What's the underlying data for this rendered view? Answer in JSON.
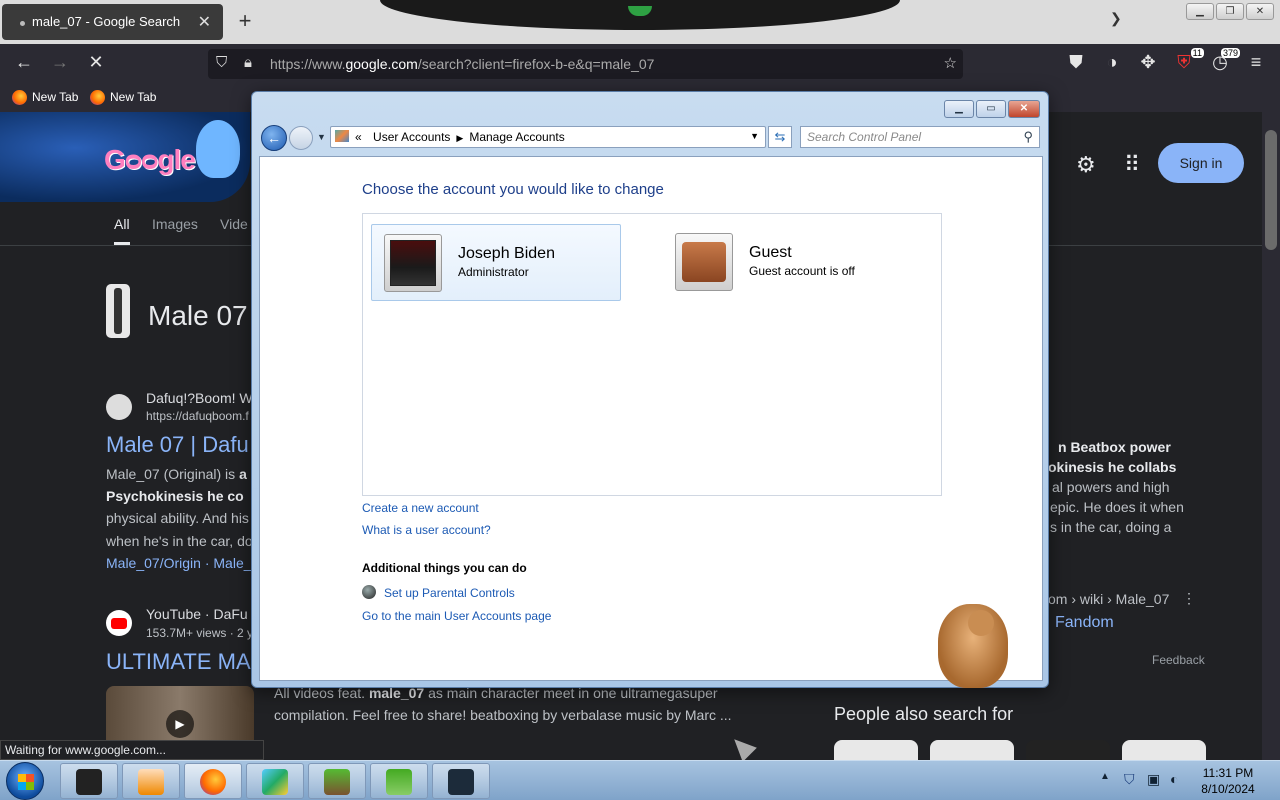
{
  "browser": {
    "tab_title": "male_07 - Google Search",
    "url_prefix": "https://www.",
    "url_domain": "google.com",
    "url_rest": "/search?client=firefox-b-e&q=male_07",
    "bookmarks": [
      "New Tab",
      "New Tab"
    ],
    "extension_badges": [
      "11",
      "379"
    ],
    "status": "Waiting for www.google.com..."
  },
  "google": {
    "signin": "Sign in",
    "tabs": [
      "All",
      "Images",
      "Vide"
    ],
    "knowledge_title": "Male 07",
    "result1": {
      "site": "Dafuq!?Boom! W",
      "url": "https://dafuqboom.f",
      "title": "Male 07 | Dafu",
      "snip1a": "Male_07 (Original) is ",
      "snip1b": "a",
      "snip2": "Psychokinesis he co",
      "snip3": "physical ability. And his",
      "snip4": "when he's in the car, do",
      "links": "Male_07/Origin · Male_"
    },
    "result2": {
      "site": "YouTube · DaFu",
      "meta": "153.7M+ views · 2 y",
      "title": "ULTIMATE MA",
      "snip1_pre": "All videos feat. ",
      "snip1_bold": "male_07",
      "snip1_post": " as main character meet in one ultramegasuper",
      "snip2": "compilation. Feel free to share! beatboxing by verbalase music by Marc ..."
    },
    "right": {
      "line1": "n Beatbox power",
      "line2": "okinesis he collabs",
      "line3": "al powers and high",
      "line4": "epic. He does it when",
      "line5": "s in the car, doing a",
      "crumb": "om › wiki › Male_07",
      "fandom": "Fandom",
      "feedback": "Feedback"
    },
    "people_also_search": "People also search for"
  },
  "control_panel": {
    "breadcrumb_lead": "«",
    "breadcrumb_1": "User Accounts",
    "breadcrumb_2": "Manage Accounts",
    "search_placeholder": "Search Control Panel",
    "heading": "Choose the account you would like to change",
    "accounts": [
      {
        "name": "Joseph Biden",
        "role": "Administrator"
      },
      {
        "name": "Guest",
        "role": "Guest account is off"
      }
    ],
    "link_create": "Create a new account",
    "link_what": "What is a user account?",
    "additional_heading": "Additional things you can do",
    "link_parental": "Set up Parental Controls",
    "link_main": "Go to the main User Accounts page"
  },
  "taskbar": {
    "time": "11:31 PM",
    "date": "8/10/2024"
  }
}
